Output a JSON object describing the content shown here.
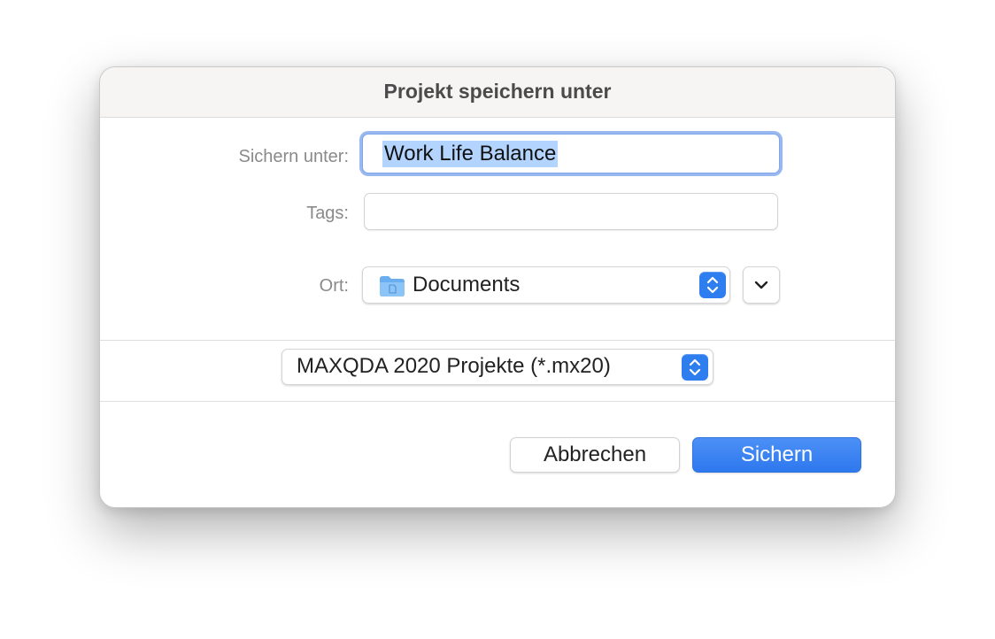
{
  "dialog": {
    "title": "Projekt speichern unter"
  },
  "save_as": {
    "label": "Sichern unter:",
    "value": "Work Life Balance"
  },
  "tags": {
    "label": "Tags:",
    "value": ""
  },
  "location": {
    "label": "Ort:",
    "selected": "Documents",
    "icon": "folder-icon"
  },
  "format": {
    "selected": "MAXQDA 2020 Projekte (*.mx20)"
  },
  "buttons": {
    "cancel": "Abbrechen",
    "save": "Sichern"
  },
  "colors": {
    "accent": "#2f7ef0",
    "selection": "#b3d4fe",
    "focus_ring": "#7fa6ea"
  }
}
